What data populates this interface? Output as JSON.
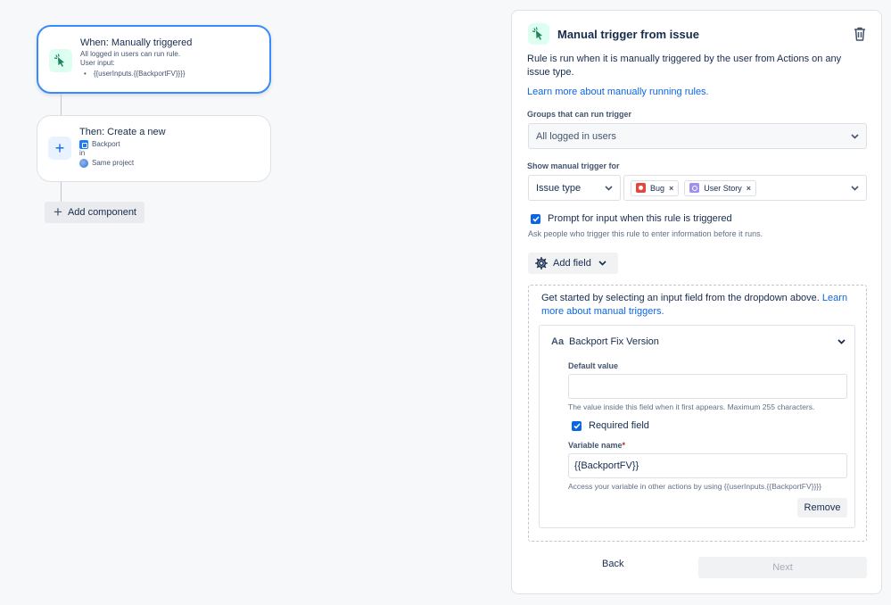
{
  "canvas": {
    "when_card": {
      "title": "When: Manually triggered",
      "line1": "All logged in users can run rule.",
      "line2": "User input:",
      "bullet": "{{userInputs.{{BackportFV}}}}"
    },
    "then_card": {
      "title": "Then: Create a new",
      "item": "Backport",
      "in_label": "in",
      "project": "Same project"
    },
    "add_component_label": "Add component"
  },
  "panel": {
    "title": "Manual trigger from issue",
    "description": "Rule is run when it is manually triggered by the user from Actions on any issue type.",
    "learn_link": "Learn more about manually running rules.",
    "groups": {
      "label": "Groups that can run trigger",
      "value": "All logged in users"
    },
    "show_for": {
      "label": "Show manual trigger for",
      "type_value": "Issue type",
      "tags": [
        "Bug",
        "User Story"
      ]
    },
    "prompt": {
      "label": "Prompt for input when this rule is triggered",
      "checked": true,
      "helper": "Ask people who trigger this rule to enter information before it runs."
    },
    "add_field_label": "Add field",
    "get_started": {
      "text": "Get started by selecting an input field from the dropdown above.",
      "link": "Learn more about manual triggers."
    },
    "field": {
      "type_icon": "Aa",
      "name": "Backport Fix Version",
      "default_label": "Default value",
      "default_value": "",
      "default_help": "The value inside this field when it first appears. Maximum 255 characters.",
      "required_label": "Required field",
      "required_checked": true,
      "variable_label": "Variable name",
      "required_mark": "*",
      "variable_value": "{{BackportFV}}",
      "variable_help": "Access your variable in other actions by using {{userInputs.{{BackportFV}}}}",
      "remove_label": "Remove"
    },
    "back_label": "Back",
    "next_label": "Next"
  },
  "colors": {
    "accent": "#0c66e4",
    "selected_border": "#388bff",
    "trigger_bg": "#dcfff1",
    "trigger_icon": "#1f845a"
  }
}
